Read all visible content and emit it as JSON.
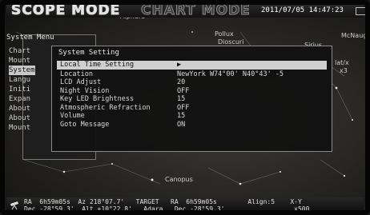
{
  "header": {
    "scope_mode": "SCOPE MODE",
    "chart_mode": "CHART MODE",
    "datetime": "2011/07/05 14:47:23"
  },
  "sky_labels": [
    "Alphard",
    "Pollux",
    "Dioscuri",
    "Sirius",
    "McNaughton",
    "Canopus",
    "lat/x",
    "x3"
  ],
  "system_menu": {
    "title": "System Menu",
    "items": [
      "Chart",
      "Mount",
      "System",
      "Langu",
      "Initi",
      "Expan",
      "About",
      "About",
      "Mount"
    ],
    "selected_index": 2
  },
  "system_setting": {
    "title": "System Setting",
    "header_row": {
      "label": "Local Time Setting",
      "value": "▶"
    },
    "rows": [
      {
        "label": "Location",
        "value": "NewYork W74°00' N40°43' -5"
      },
      {
        "label": "LCD Adjust",
        "value": "20"
      },
      {
        "label": "Night Vision",
        "value": "OFF"
      },
      {
        "label": "Key LED Brightness",
        "value": "15"
      },
      {
        "label": "Atmospheric Refraction",
        "value": "OFF"
      },
      {
        "label": "Volume",
        "value": "15"
      },
      {
        "label": "Goto Message",
        "value": "ON"
      }
    ]
  },
  "status": {
    "line1": "RA  6h59m05s  Az 218°07.7'   TARGET   RA  6h59m05s        Align:5    X-Y",
    "line2": "Dec -28°59.3'  Alt +10°22.8'   Adara   Dec -28°59.3'                  x500"
  },
  "colors": {
    "highlight": "#cfcfcf",
    "panel": "#121212",
    "text": "#d9d9d9"
  }
}
